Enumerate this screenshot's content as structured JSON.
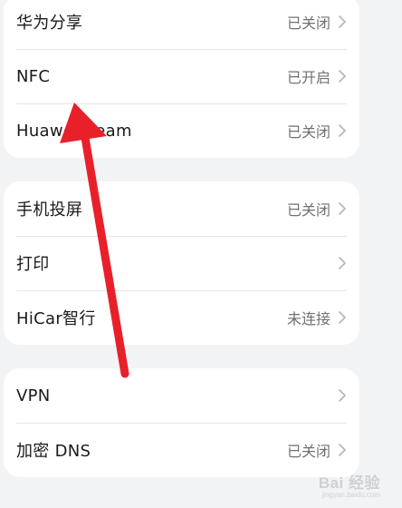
{
  "groups": [
    {
      "items": [
        {
          "label": "华为分享",
          "value": "已关闭"
        },
        {
          "label": "NFC",
          "value": "已开启"
        },
        {
          "label": "Huawei Beam",
          "value": "已关闭"
        }
      ]
    },
    {
      "items": [
        {
          "label": "手机投屏",
          "value": "已关闭"
        },
        {
          "label": "打印",
          "value": ""
        },
        {
          "label": "HiCar智行",
          "value": "未连接"
        }
      ]
    },
    {
      "items": [
        {
          "label": "VPN",
          "value": ""
        },
        {
          "label": "加密 DNS",
          "value": "已关闭"
        }
      ]
    }
  ],
  "annotation": {
    "color": "#e8202a",
    "icon": "arrow-up-icon"
  },
  "watermark": {
    "text": "Bai 经验",
    "subtext": "jingyan.baidu.com"
  }
}
